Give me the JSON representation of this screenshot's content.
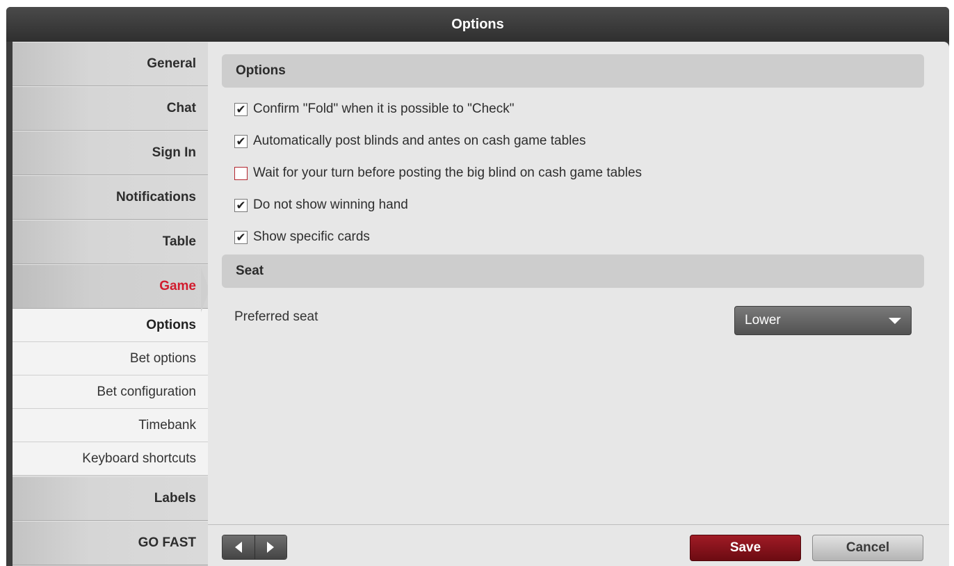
{
  "window": {
    "title": "Options"
  },
  "sidebar": {
    "items": [
      {
        "label": "General"
      },
      {
        "label": "Chat"
      },
      {
        "label": "Sign In"
      },
      {
        "label": "Notifications"
      },
      {
        "label": "Table"
      },
      {
        "label": "Game",
        "active": true
      },
      {
        "label": "Labels"
      },
      {
        "label": "GO FAST"
      }
    ],
    "sub_items": [
      {
        "label": "Options",
        "current": true
      },
      {
        "label": "Bet options"
      },
      {
        "label": "Bet configuration"
      },
      {
        "label": "Timebank"
      },
      {
        "label": "Keyboard shortcuts"
      }
    ]
  },
  "main": {
    "options_section": {
      "header": "Options",
      "items": [
        {
          "label": "Confirm \"Fold\" when it is possible to \"Check\"",
          "checked": true
        },
        {
          "label": "Automatically post blinds and antes on cash game tables",
          "checked": true
        },
        {
          "label": "Wait for your turn before posting the big blind on cash game tables",
          "checked": false
        },
        {
          "label": "Do not show winning hand",
          "checked": true
        },
        {
          "label": "Show specific cards",
          "checked": true
        }
      ]
    },
    "seat_section": {
      "header": "Seat",
      "preferred_label": "Preferred seat",
      "preferred_value": "Lower"
    }
  },
  "footer": {
    "save_label": "Save",
    "cancel_label": "Cancel"
  },
  "colors": {
    "active_accent": "#d11c2e",
    "save_button": "#8a1019"
  }
}
